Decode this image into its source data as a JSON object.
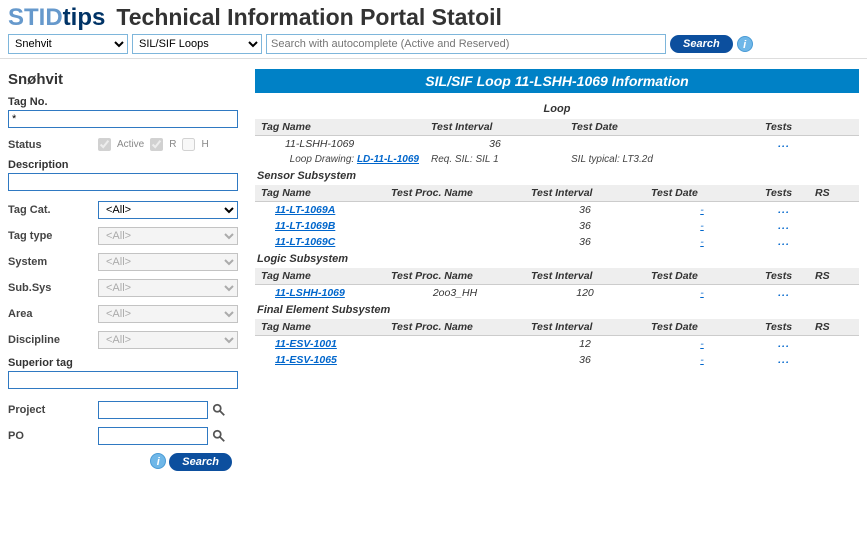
{
  "header": {
    "logo_stid": "STID",
    "logo_tips": "tips",
    "title": "Technical Information Portal Statoil"
  },
  "topbar": {
    "plant_select": "Snehvit",
    "type_select": "SIL/SIF Loops",
    "search_placeholder": "Search with autocomplete (Active and Reserved)",
    "search_btn": "Search"
  },
  "sidebar": {
    "title": "Snøhvit",
    "tag_no_label": "Tag No.",
    "tag_no_value": "*",
    "status_label": "Status",
    "status_active": "Active",
    "status_r": "R",
    "status_h": "H",
    "desc_label": "Description",
    "desc_value": "",
    "tagcat_label": "Tag Cat.",
    "tagcat_value": "<All>",
    "tagtype_label": "Tag type",
    "tagtype_value": "<All>",
    "system_label": "System",
    "system_value": "<All>",
    "subsys_label": "Sub.Sys",
    "subsys_value": "<All>",
    "area_label": "Area",
    "area_value": "<All>",
    "disc_label": "Discipline",
    "disc_value": "<All>",
    "suptag_label": "Superior tag",
    "suptag_value": "",
    "project_label": "Project",
    "project_value": "",
    "po_label": "PO",
    "po_value": "",
    "search_btn": "Search"
  },
  "main": {
    "banner": "SIL/SIF Loop 11-LSHH-1069 Information",
    "loop_head": "Loop",
    "loop_cols": {
      "tagname": "Tag Name",
      "ti": "Test Interval",
      "td": "Test Date",
      "tests": "Tests"
    },
    "loop_row": {
      "tag": "11-LSHH-1069",
      "ti": "36"
    },
    "req_row": {
      "drawing_lbl": "Loop Drawing:",
      "drawing_val": "LD-11-L-1069",
      "req": "Req. SIL: SIL 1",
      "sil": "SIL typical: LT3.2d"
    },
    "sensor_head": "Sensor Subsystem",
    "sub_cols": {
      "tagname": "Tag Name",
      "proc": "Test Proc. Name",
      "ti": "Test Interval",
      "td": "Test Date",
      "tests": "Tests",
      "rs": "RS"
    },
    "sensor_rows": [
      {
        "tag": "11-LT-1069A",
        "ti": "36"
      },
      {
        "tag": "11-LT-1069B",
        "ti": "36"
      },
      {
        "tag": "11-LT-1069C",
        "ti": "36"
      }
    ],
    "logic_head": "Logic Subsystem",
    "logic_rows": [
      {
        "tag": "11-LSHH-1069",
        "proc": "2oo3_HH",
        "ti": "120"
      }
    ],
    "final_head": "Final Element Subsystem",
    "final_rows": [
      {
        "tag": "11-ESV-1001",
        "ti": "12"
      },
      {
        "tag": "11-ESV-1065",
        "ti": "36"
      }
    ]
  }
}
